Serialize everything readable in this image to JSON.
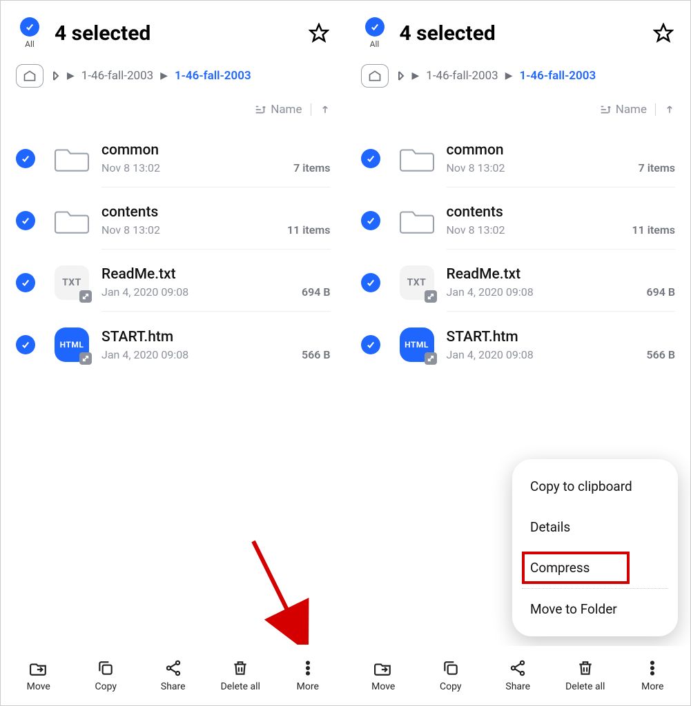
{
  "header": {
    "select_all_label": "All",
    "title": "4 selected"
  },
  "breadcrumb": {
    "items": [
      "1-46-fall-2003",
      "1-46-fall-2003"
    ]
  },
  "sort": {
    "label": "Name"
  },
  "files": [
    {
      "name": "common",
      "date": "Nov 8 13:02",
      "meta": "7 items",
      "icon": "folder"
    },
    {
      "name": "contents",
      "date": "Nov 8 13:02",
      "meta": "11 items",
      "icon": "folder"
    },
    {
      "name": "ReadMe.txt",
      "date": "Jan 4, 2020 09:08",
      "meta": "694 B",
      "icon": "txt",
      "icon_label": "TXT"
    },
    {
      "name": "START.htm",
      "date": "Jan 4, 2020 09:08",
      "meta": "566 B",
      "icon": "html",
      "icon_label": "HTML"
    }
  ],
  "bottom_bar": {
    "move": "Move",
    "copy": "Copy",
    "share": "Share",
    "delete_all": "Delete all",
    "more": "More"
  },
  "more_menu": {
    "copy_clipboard": "Copy to clipboard",
    "details": "Details",
    "compress": "Compress",
    "move_folder": "Move to Folder"
  }
}
